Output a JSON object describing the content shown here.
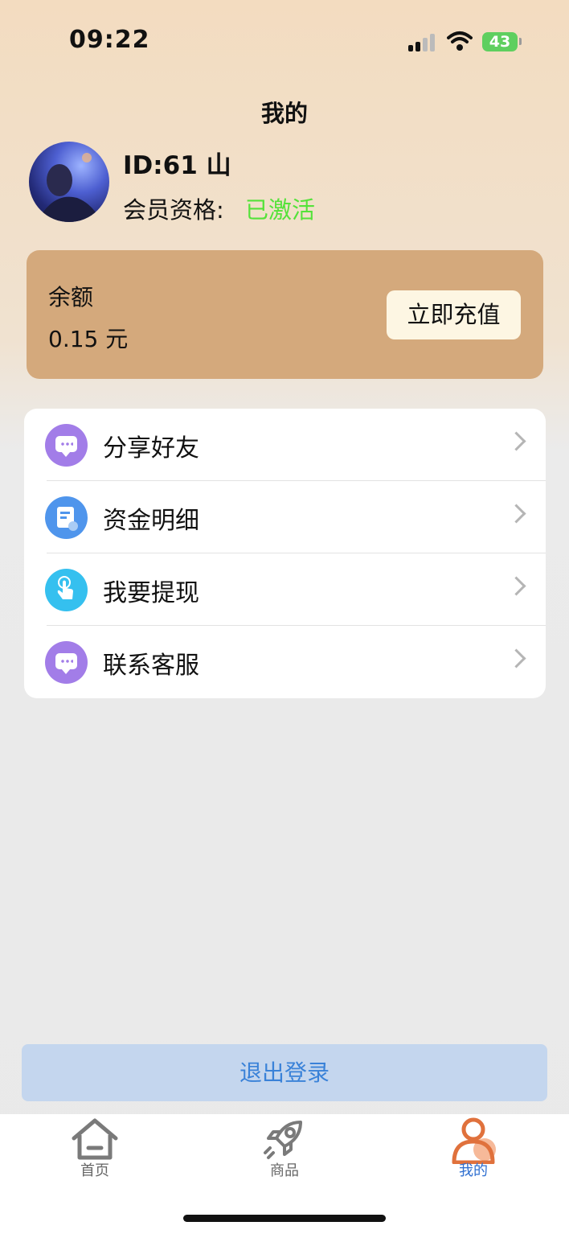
{
  "status_bar": {
    "time": "09:22",
    "battery": "43"
  },
  "header": {
    "title": "我的"
  },
  "profile": {
    "id_text": "ID:61 山",
    "member_label": "会员资格:",
    "member_status": "已激活"
  },
  "balance": {
    "label": "余额",
    "value": "0.15 元",
    "recharge_label": "立即充值"
  },
  "menu": {
    "items": [
      {
        "label": "分享好友",
        "icon": "chat-bubble-icon"
      },
      {
        "label": "资金明细",
        "icon": "document-icon"
      },
      {
        "label": "我要提现",
        "icon": "hand-tap-icon"
      },
      {
        "label": "联系客服",
        "icon": "chat-bubble-icon"
      }
    ]
  },
  "logout_label": "退出登录",
  "tabbar": {
    "tabs": [
      {
        "label": "首页",
        "icon": "home-icon"
      },
      {
        "label": "商品",
        "icon": "rocket-icon"
      },
      {
        "label": "我的",
        "icon": "person-icon",
        "active": true
      }
    ]
  },
  "colors": {
    "accent_active": "#e0713c",
    "member_status": "#55e23a",
    "logout_text": "#3a82d8"
  }
}
